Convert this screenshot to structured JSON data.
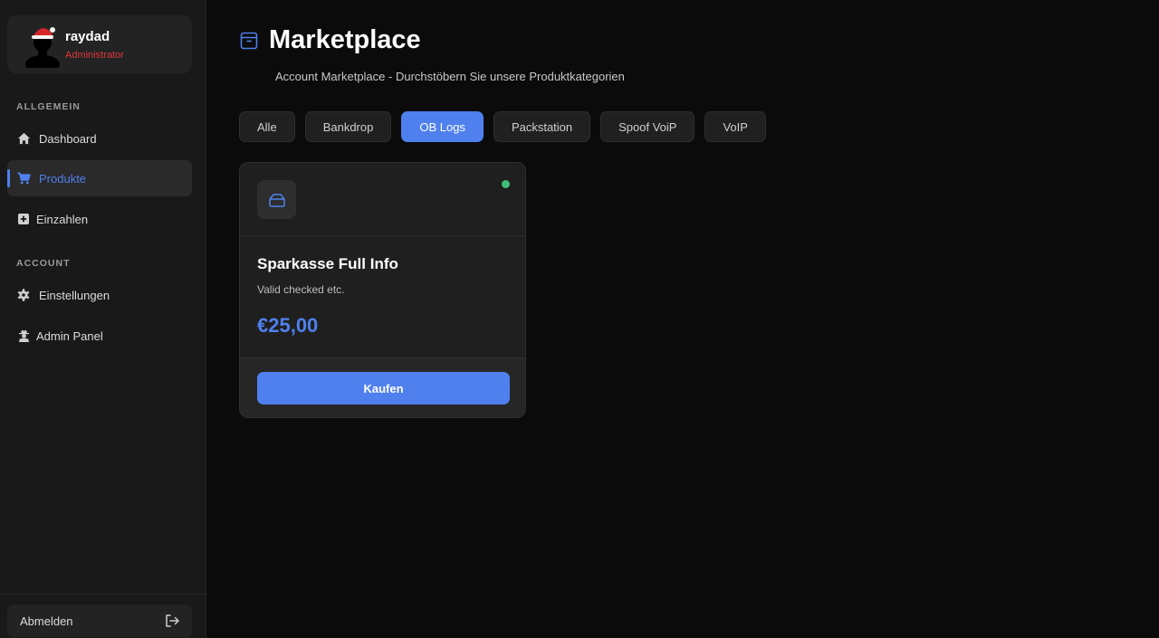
{
  "user": {
    "name": "raydad",
    "role": "Administrator"
  },
  "sidebar": {
    "sections": [
      {
        "label": "ALLGEMEIN"
      },
      {
        "label": "ACCOUNT"
      }
    ],
    "items": [
      {
        "label": "Dashboard",
        "icon": "home-icon"
      },
      {
        "label": "Produkte",
        "icon": "cart-icon",
        "active": true
      },
      {
        "label": "Einzahlen",
        "icon": "plus-square-icon"
      },
      {
        "label": "Einstellungen",
        "icon": "gear-icon"
      },
      {
        "label": "Admin Panel",
        "icon": "user-secret-icon"
      }
    ],
    "logout_label": "Abmelden"
  },
  "header": {
    "title": "Marketplace",
    "subtitle": "Account Marketplace - Durchstöbern Sie unsere Produktkategorien"
  },
  "tabs": [
    {
      "label": "Alle"
    },
    {
      "label": "Bankdrop"
    },
    {
      "label": "OB Logs",
      "active": true
    },
    {
      "label": "Packstation"
    },
    {
      "label": "Spoof VoiP"
    },
    {
      "label": "VoIP"
    }
  ],
  "products": [
    {
      "title": "Sparkasse Full Info",
      "description": "Valid checked etc.",
      "price": "€25,00",
      "button_label": "Kaufen",
      "status_color": "#3fc07a"
    }
  ],
  "colors": {
    "accent": "#4f80ee",
    "role": "#e2373a",
    "status": "#3fc07a"
  }
}
